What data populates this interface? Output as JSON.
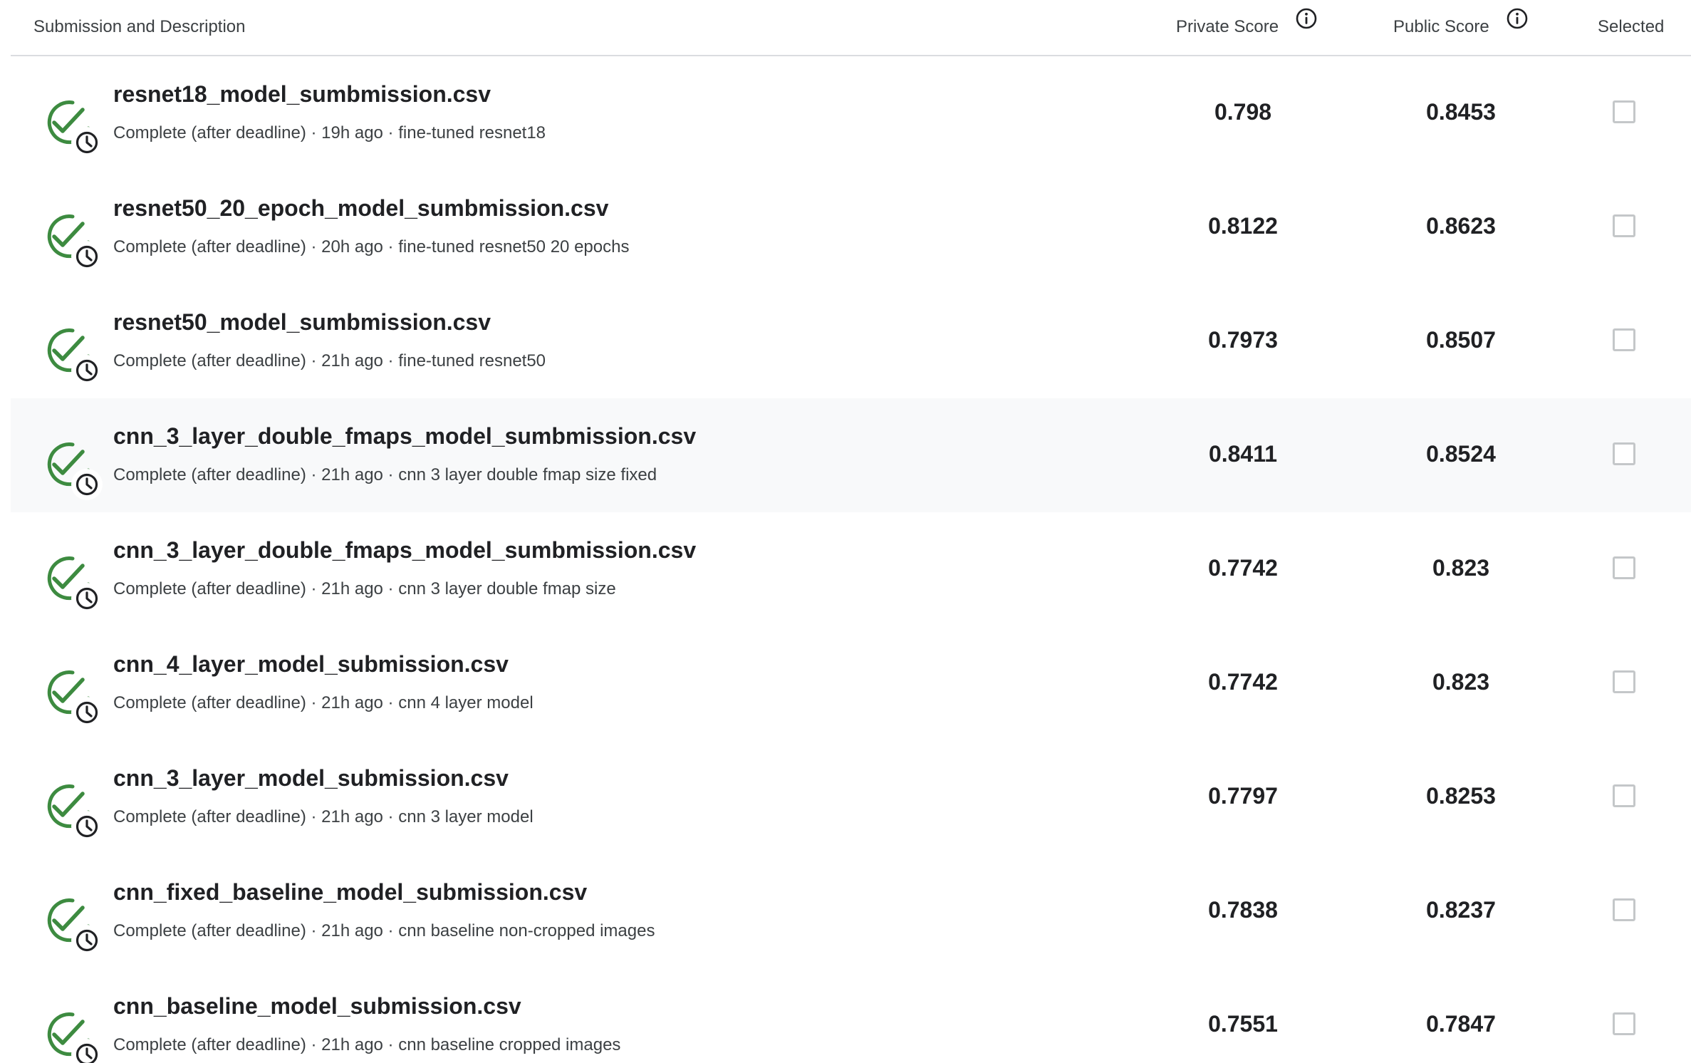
{
  "header": {
    "submission_label": "Submission and Description",
    "private_label": "Private Score",
    "public_label": "Public Score",
    "selected_label": "Selected"
  },
  "icons": {
    "info": "info-icon",
    "status": "check-complete-clock-icon"
  },
  "colors": {
    "success_green": "#3d8b40",
    "row_highlight": "#f8f9fa"
  },
  "rows": [
    {
      "title": "resnet18_model_sumbmission.csv",
      "meta": "Complete (after deadline) · 19h ago · fine-tuned resnet18",
      "private": "0.798",
      "public": "0.8453",
      "selected": false,
      "highlighted": false
    },
    {
      "title": "resnet50_20_epoch_model_sumbmission.csv",
      "meta": "Complete (after deadline) · 20h ago · fine-tuned resnet50 20 epochs",
      "private": "0.8122",
      "public": "0.8623",
      "selected": false,
      "highlighted": false
    },
    {
      "title": "resnet50_model_sumbmission.csv",
      "meta": "Complete (after deadline) · 21h ago · fine-tuned resnet50",
      "private": "0.7973",
      "public": "0.8507",
      "selected": false,
      "highlighted": false
    },
    {
      "title": "cnn_3_layer_double_fmaps_model_sumbmission.csv",
      "meta": "Complete (after deadline) · 21h ago · cnn 3 layer double fmap size fixed",
      "private": "0.8411",
      "public": "0.8524",
      "selected": false,
      "highlighted": true
    },
    {
      "title": "cnn_3_layer_double_fmaps_model_sumbmission.csv",
      "meta": "Complete (after deadline) · 21h ago · cnn 3 layer double fmap size",
      "private": "0.7742",
      "public": "0.823",
      "selected": false,
      "highlighted": false
    },
    {
      "title": "cnn_4_layer_model_submission.csv",
      "meta": "Complete (after deadline) · 21h ago · cnn 4 layer model",
      "private": "0.7742",
      "public": "0.823",
      "selected": false,
      "highlighted": false
    },
    {
      "title": "cnn_3_layer_model_submission.csv",
      "meta": "Complete (after deadline) · 21h ago · cnn 3 layer model",
      "private": "0.7797",
      "public": "0.8253",
      "selected": false,
      "highlighted": false
    },
    {
      "title": "cnn_fixed_baseline_model_submission.csv",
      "meta": "Complete (after deadline) · 21h ago · cnn baseline non-cropped images",
      "private": "0.7838",
      "public": "0.8237",
      "selected": false,
      "highlighted": false
    },
    {
      "title": "cnn_baseline_model_submission.csv",
      "meta": "Complete (after deadline) · 21h ago · cnn baseline cropped images",
      "private": "0.7551",
      "public": "0.7847",
      "selected": false,
      "highlighted": false
    }
  ]
}
